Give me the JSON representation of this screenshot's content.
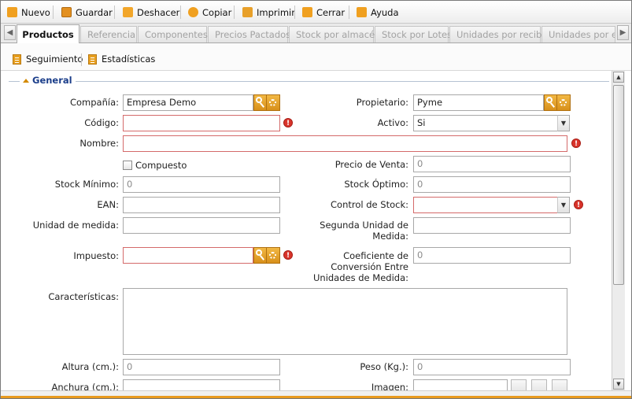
{
  "toolbar": {
    "new": "Nuevo",
    "save": "Guardar",
    "undo": "Deshacer",
    "copy": "Copiar",
    "print": "Imprimir",
    "close": "Cerrar",
    "help": "Ayuda"
  },
  "tabs": [
    {
      "label": "Productos",
      "active": true
    },
    {
      "label": "Referencia"
    },
    {
      "label": "Componentes"
    },
    {
      "label": "Precios Pactados"
    },
    {
      "label": "Stock por almacén"
    },
    {
      "label": "Stock por Lotes"
    },
    {
      "label": "Unidades por recibir"
    },
    {
      "label": "Unidades por env"
    }
  ],
  "subtoolbar": {
    "tracking": "Seguimiento",
    "stats": "Estadísticas"
  },
  "section": {
    "title": "General"
  },
  "form": {
    "company_label": "Compañía:",
    "company_value": "Empresa Demo",
    "owner_label": "Propietario:",
    "owner_value": "Pyme",
    "code_label": "Código:",
    "code_value": "",
    "active_label": "Activo:",
    "active_value": "Si",
    "name_label": "Nombre:",
    "name_value": "",
    "compound_label": "Compuesto",
    "sale_price_label": "Precio de Venta:",
    "sale_price_value": "0",
    "min_stock_label": "Stock Mínimo:",
    "min_stock_value": "0",
    "opt_stock_label": "Stock Óptimo:",
    "opt_stock_value": "0",
    "ean_label": "EAN:",
    "ean_value": "",
    "stock_control_label": "Control de Stock:",
    "stock_control_value": "",
    "unit_label": "Unidad de medida:",
    "unit_value": "",
    "second_unit_label_1": "Segunda Unidad de",
    "second_unit_label_2": "Medida:",
    "second_unit_value": "",
    "tax_label": "Impuesto:",
    "tax_value": "",
    "conv_label_1": "Coeficiente de",
    "conv_label_2": "Conversión Entre",
    "conv_label_3": "Unidades de Medida:",
    "conv_value": "0",
    "features_label": "Características:",
    "features_value": "",
    "height_label": "Altura (cm.):",
    "height_value": "0",
    "weight_label": "Peso (Kg.):",
    "weight_value": "0",
    "width_label": "Anchura (cm.):",
    "width_value": "",
    "image_label": "Imagen:",
    "image_value": ""
  },
  "colors": {
    "accent": "#e89a1e",
    "section_title": "#1b3e8a",
    "error": "#d9342b"
  }
}
